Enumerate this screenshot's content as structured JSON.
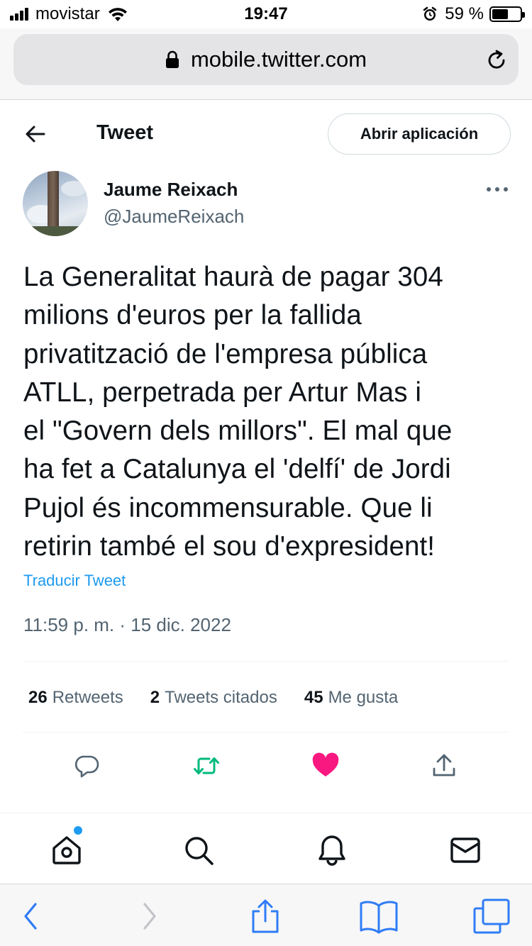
{
  "status_bar": {
    "carrier": "movistar",
    "time": "19:47",
    "battery_text": "59 %",
    "battery_level": 0.59
  },
  "browser": {
    "url": "mobile.twitter.com"
  },
  "header": {
    "title": "Tweet",
    "open_app_label": "Abrir aplicación"
  },
  "tweet": {
    "author_name": "Jaume Reixach",
    "author_handle": "@JaumeReixach",
    "text": "La Generalitat haurà de pagar 304\nmilions d'euros per la fallida\nprivatització de l'empresa pública\nATLL, perpetrada per Artur Mas i\nel \"Govern dels millors\". El mal que\nha fet a Catalunya el 'delfí' de Jordi\nPujol és incommensurable. Que li\nretirin també el sou d'expresident!",
    "translate_label": "Traducir Tweet",
    "timestamp": "11:59 p. m. · 15 dic. 2022"
  },
  "stats": {
    "retweets_count": "26",
    "retweets_label": "Retweets",
    "quotes_count": "2",
    "quotes_label": "Tweets citados",
    "likes_count": "45",
    "likes_label": "Me gusta"
  },
  "actions": {
    "reply_icon": "reply-icon",
    "retweet_icon": "retweet-icon",
    "like_icon": "heart-icon",
    "share_icon": "share-icon"
  },
  "colors": {
    "accent": "#1d9bf0",
    "retweet": "#00ba7c",
    "like": "#f91880",
    "safari_blue": "#2f7cf6"
  }
}
